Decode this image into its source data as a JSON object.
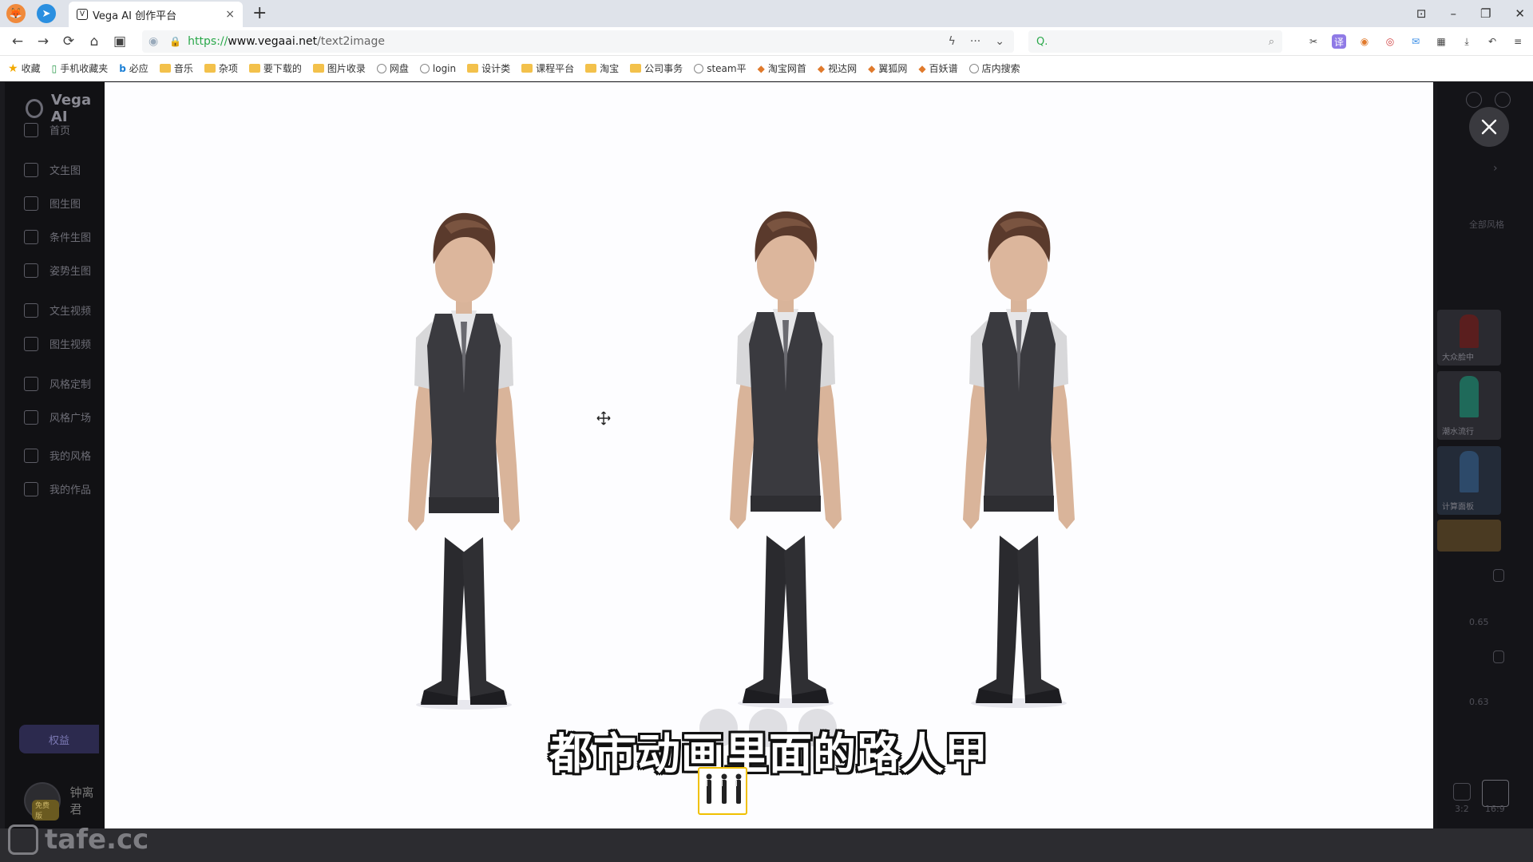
{
  "browser": {
    "tab_title": "Vega AI 创作平台",
    "tab_close": "×",
    "new_tab": "+",
    "url_protocol": "https://",
    "url_host": "www.vegaai.net",
    "url_path": "/text2image",
    "search_text": "Q.",
    "window_controls": [
      "⊡",
      "–",
      "❐",
      "✕"
    ]
  },
  "bookmarks": [
    {
      "label": "收藏",
      "type": "star"
    },
    {
      "label": "手机收藏夹",
      "type": "phone"
    },
    {
      "label": "必应",
      "type": "bing"
    },
    {
      "label": "音乐",
      "type": "folder"
    },
    {
      "label": "杂项",
      "type": "folder"
    },
    {
      "label": "要下载的",
      "type": "folder"
    },
    {
      "label": "图片收录",
      "type": "folder"
    },
    {
      "label": "网盘",
      "type": "globe"
    },
    {
      "label": "login",
      "type": "globe"
    },
    {
      "label": "设计类",
      "type": "folder"
    },
    {
      "label": "课程平台",
      "type": "folder"
    },
    {
      "label": "淘宝",
      "type": "folder"
    },
    {
      "label": "公司事务",
      "type": "folder"
    },
    {
      "label": "steam平",
      "type": "globe"
    },
    {
      "label": "淘宝网首",
      "type": "site"
    },
    {
      "label": "视达网",
      "type": "site"
    },
    {
      "label": "翼狐网",
      "type": "site"
    },
    {
      "label": "百妖谱",
      "type": "site"
    },
    {
      "label": "店内搜索",
      "type": "globe"
    }
  ],
  "app": {
    "brand": "Vega AI",
    "nav": [
      "首页",
      "文生图",
      "图生图",
      "条件生图",
      "姿势生图",
      "文生视频",
      "图生视频",
      "风格定制",
      "风格广场",
      "我的风格",
      "我的作品"
    ],
    "upgrade_label": "权益",
    "user_name": "钟离君",
    "user_badge": "免费版",
    "right_panel": {
      "link": "全部风格",
      "thumb_captions": [
        "大众脸中",
        "潮水流行",
        "计算面板",
        ""
      ],
      "values": [
        "0.65",
        "0.63"
      ],
      "ratios": [
        "3:2",
        "16:9"
      ]
    }
  },
  "modal": {
    "subtitle": "都市动画里面的路人甲",
    "close": "✕"
  },
  "watermark": "tafe.cc"
}
